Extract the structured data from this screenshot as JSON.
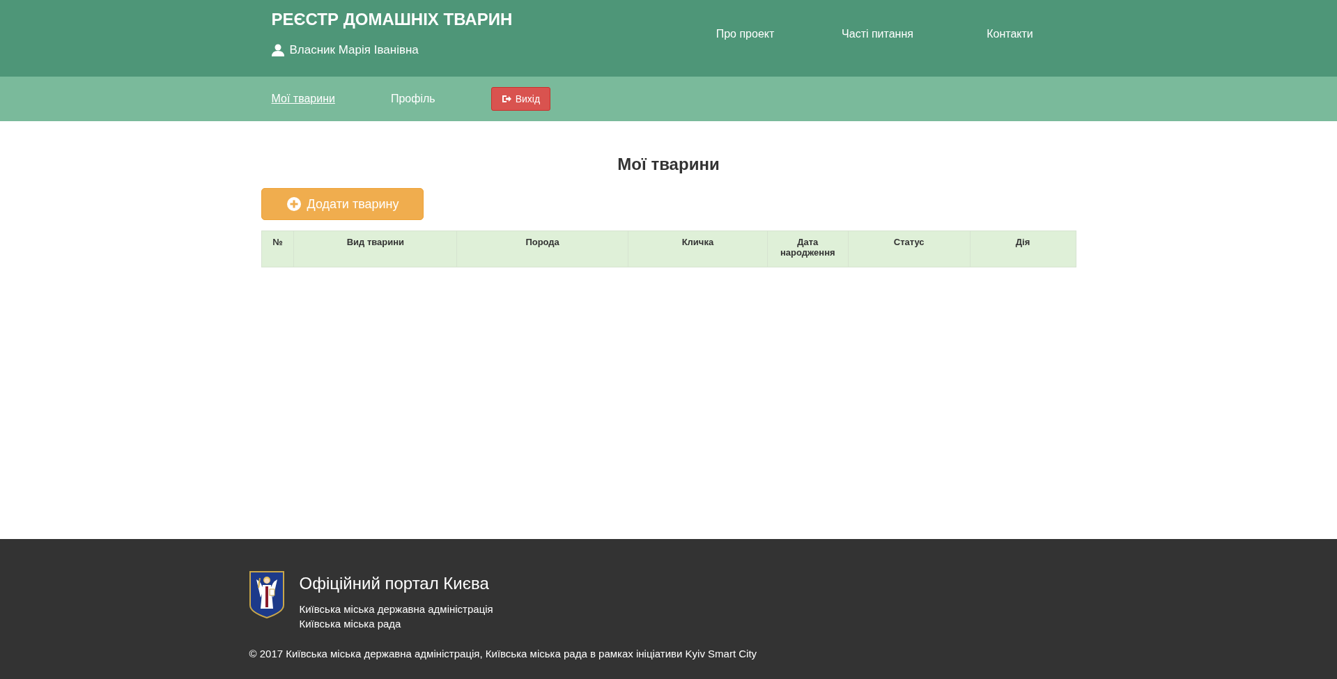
{
  "header": {
    "title": "РЕЄСТР ДОМАШНІХ ТВАРИН",
    "user": "Власник Марія Іванівна",
    "nav": [
      "Про проект",
      "Часті питання",
      "Контакти"
    ]
  },
  "subnav": {
    "items": [
      {
        "label": "Мої тварини",
        "selected": true
      },
      {
        "label": "Профіль",
        "selected": false
      }
    ],
    "logout": "Вихід"
  },
  "page": {
    "heading": "Мої тварини",
    "add_button": "Додати тварину"
  },
  "table": {
    "columns": [
      "№",
      "Вид тварини",
      "Порода",
      "Кличка",
      "Дата народження",
      "Статус",
      "Дія"
    ]
  },
  "footer": {
    "title": "Офіційний портал Києва",
    "lines": [
      "Київська міська державна адміністрація",
      "Київська міська рада"
    ],
    "copyright": "© 2017 Київська міська державна адміністрація, Київська міська рада в рамках ініціативи Kyiv Smart City"
  }
}
